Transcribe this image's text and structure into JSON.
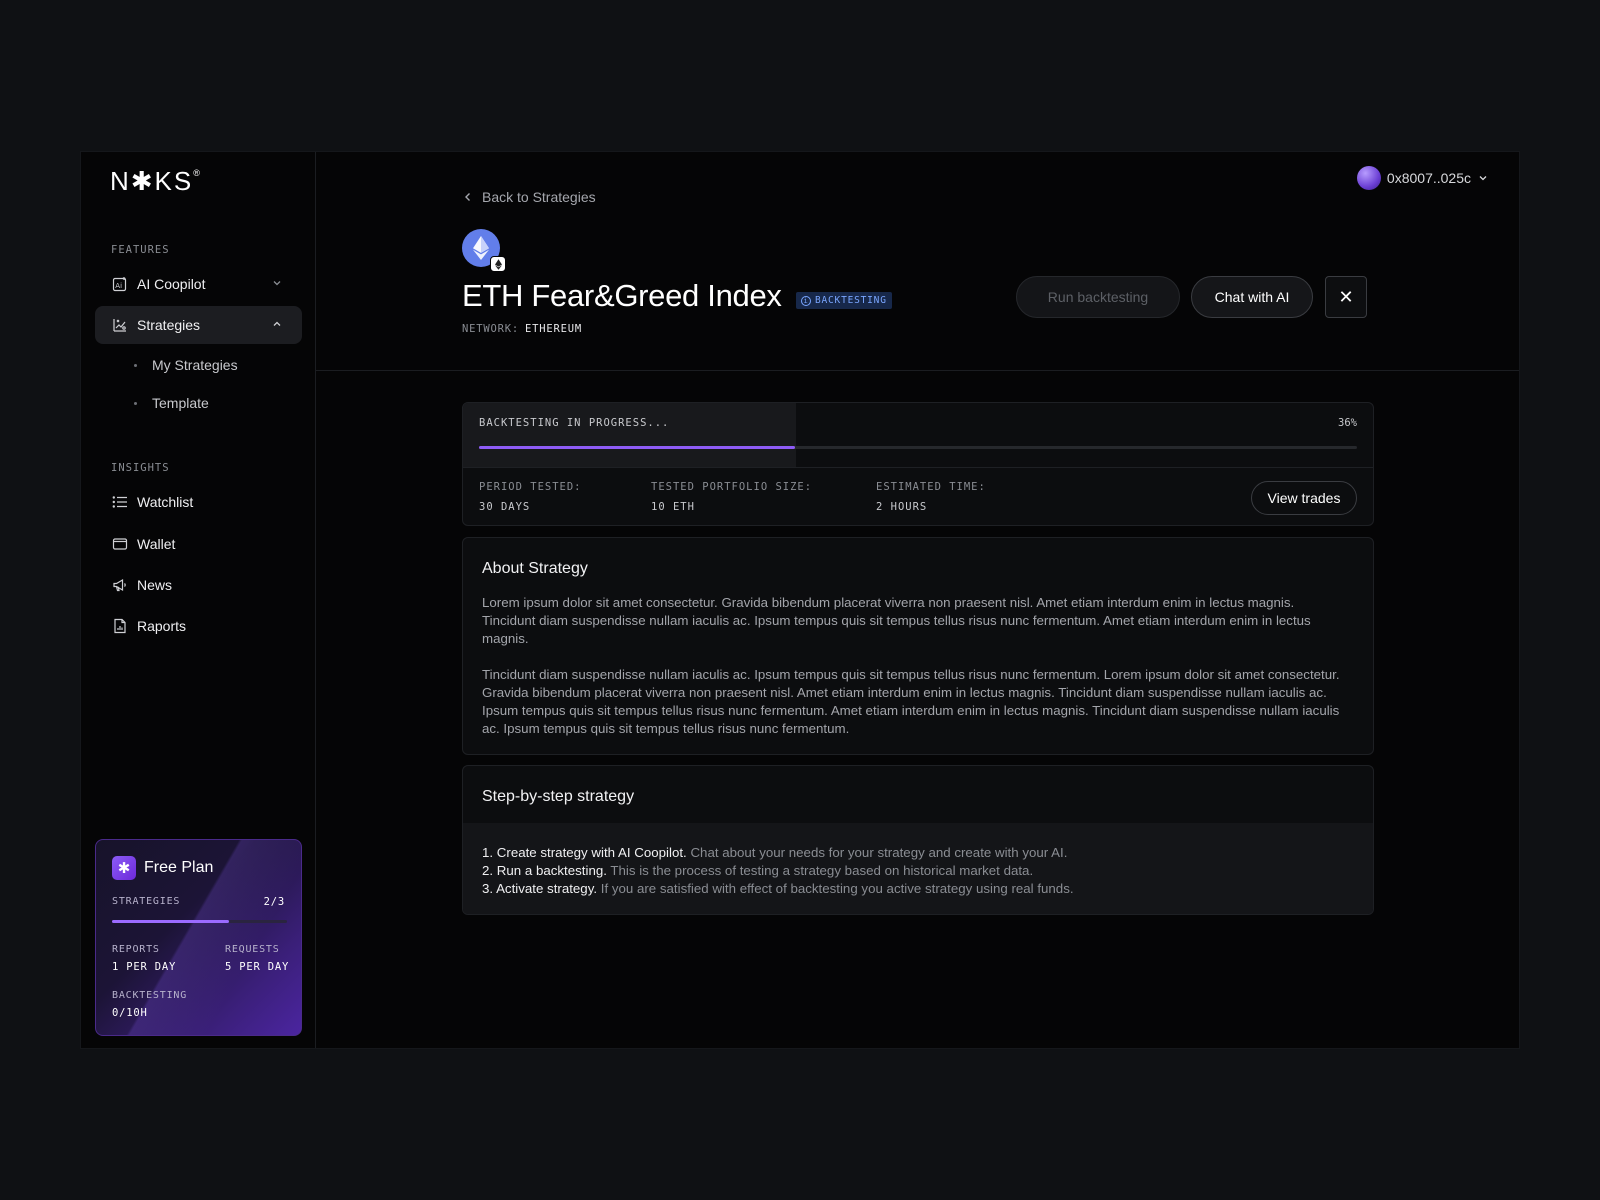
{
  "brand": {
    "logo": "N✱KS",
    "logo_mark": "®"
  },
  "sidebar": {
    "features_label": "FEATURES",
    "insights_label": "INSIGHTS",
    "features": [
      {
        "label": "AI Coopilot"
      },
      {
        "label": "Strategies"
      }
    ],
    "sub_items": [
      {
        "label": "My Strategies"
      },
      {
        "label": "Template"
      }
    ],
    "insights": [
      {
        "label": "Watchlist"
      },
      {
        "label": "Wallet"
      },
      {
        "label": "News"
      },
      {
        "label": "Raports"
      }
    ]
  },
  "plan": {
    "title": "Free Plan",
    "strategies_label": "STRATEGIES",
    "strategies_value": "2/3",
    "strategies_progress": 0.667,
    "reports_label": "REPORTS",
    "reports_value": "1 PER DAY",
    "requests_label": "REQUESTS",
    "requests_value": "5 PER DAY",
    "backtesting_label": "BACKTESTING",
    "backtesting_value": "0/10H"
  },
  "header": {
    "wallet_address": "0x8007..025c",
    "back_label": "Back to Strategies",
    "title": "ETH Fear&Greed Index",
    "status_badge": "BACKTESTING",
    "network_label": "NETWORK:",
    "network_value": "ETHEREUM",
    "run_button": "Run backtesting",
    "chat_button": "Chat with AI",
    "close_icon": "✕"
  },
  "progress": {
    "label": "BACKTESTING IN PROGRESS...",
    "percent_text": "36%",
    "percent": 36,
    "stats": [
      {
        "key": "PERIOD TESTED:",
        "value": "30 DAYS"
      },
      {
        "key": "TESTED PORTFOLIO SIZE:",
        "value": "10 ETH"
      },
      {
        "key": "ESTIMATED TIME:",
        "value": "2 HOURS"
      }
    ],
    "view_trades": "View trades"
  },
  "about": {
    "title": "About Strategy",
    "paragraphs": [
      "Lorem ipsum dolor sit amet consectetur. Gravida bibendum placerat viverra non praesent nisl. Amet etiam interdum enim in lectus magnis. Tincidunt diam suspendisse nullam iaculis ac. Ipsum tempus quis sit tempus tellus risus nunc fermentum. Amet etiam interdum enim in lectus magnis.",
      "Tincidunt diam suspendisse nullam iaculis ac. Ipsum tempus quis sit tempus tellus risus nunc fermentum. Lorem ipsum dolor sit amet consectetur. Gravida bibendum placerat viverra non praesent nisl. Amet etiam interdum enim in lectus magnis. Tincidunt diam suspendisse nullam iaculis ac. Ipsum tempus quis sit tempus tellus risus nunc fermentum. Amet etiam interdum enim in lectus magnis. Tincidunt diam suspendisse nullam iaculis ac. Ipsum tempus quis sit tempus tellus risus nunc fermentum."
    ]
  },
  "steps": {
    "title": "Step-by-step strategy",
    "items": [
      {
        "num": "1.",
        "bold": "Create strategy with AI Coopilot.",
        "text": " Chat about your needs for your strategy and create with your AI."
      },
      {
        "num": "2.",
        "bold": "Run a backtesting.",
        "text": " This is the process of testing a strategy based on historical market data."
      },
      {
        "num": "3.",
        "bold": "Activate strategy.",
        "text": " If you are satisfied with effect of backtesting you active strategy using real funds."
      }
    ]
  },
  "colors": {
    "accent": "#8e5cf6",
    "eth": "#627eea",
    "badge_bg": "#17284a",
    "badge_text": "#7aa6ff"
  },
  "icons": {
    "ai": "ai-copilot-icon",
    "strategies": "strategies-icon",
    "watchlist": "list-icon",
    "wallet": "wallet-icon",
    "news": "megaphone-icon",
    "raports": "report-icon"
  }
}
